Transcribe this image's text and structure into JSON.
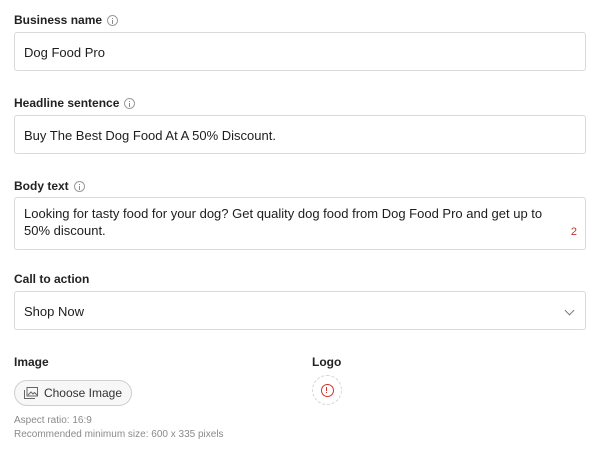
{
  "business_name": {
    "label": "Business name",
    "value": "Dog Food Pro"
  },
  "headline": {
    "label": "Headline sentence",
    "value": "Buy The Best Dog Food At A 50% Discount."
  },
  "body_text": {
    "label": "Body text",
    "value": "Looking for tasty food for your dog? Get quality dog food from Dog Food Pro and get up to 50% discount.",
    "counter": "2"
  },
  "call_to_action": {
    "label": "Call to action",
    "selected": "Shop Now"
  },
  "image": {
    "label": "Image",
    "button_label": "Choose Image",
    "aspect_ratio": "Aspect ratio: 16:9",
    "min_size": "Recommended minimum size: 600 x 335 pixels"
  },
  "logo": {
    "label": "Logo"
  },
  "colors": {
    "border": "#d9d9d9",
    "error": "#d93025",
    "hint": "#8a8a8a"
  }
}
